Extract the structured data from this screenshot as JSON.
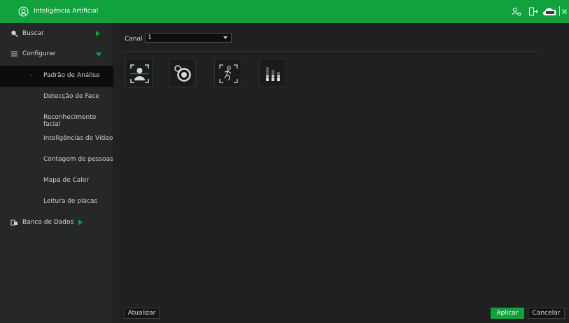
{
  "app": {
    "title": "Inteligência Artificial",
    "accent_color": "#11a23d",
    "cloud_icon_text": "intelbras Cloud"
  },
  "toolbar_icons": [
    "user-settings-icon",
    "logout-icon",
    "cloud-icon",
    "close-icon"
  ],
  "sidebar": {
    "items": [
      {
        "label": "Buscar",
        "icon": "search-icon"
      },
      {
        "label": "Configurar",
        "icon": "list-icon"
      },
      {
        "label": "Padrão de Análise",
        "active": true
      },
      {
        "label": "Detecção de Face"
      },
      {
        "label": "Reconhecimento facial"
      },
      {
        "label": "Inteligências de Vídeo"
      },
      {
        "label": "Contagem de pessoas"
      },
      {
        "label": "Mapa de Calor"
      },
      {
        "label": "Leitura de placas"
      },
      {
        "label": "Banco de Dados",
        "icon": "database-icon"
      }
    ]
  },
  "main": {
    "canal_label": "Canal",
    "canal_value": "1",
    "tiles": [
      {
        "icon": "face-detection-icon"
      },
      {
        "icon": "camera-lens-icon"
      },
      {
        "icon": "person-motion-icon"
      },
      {
        "icon": "people-counting-icon"
      }
    ],
    "refresh_label": "Atualizar",
    "apply_label": "Aplicar",
    "cancel_label": "Cancelar"
  }
}
